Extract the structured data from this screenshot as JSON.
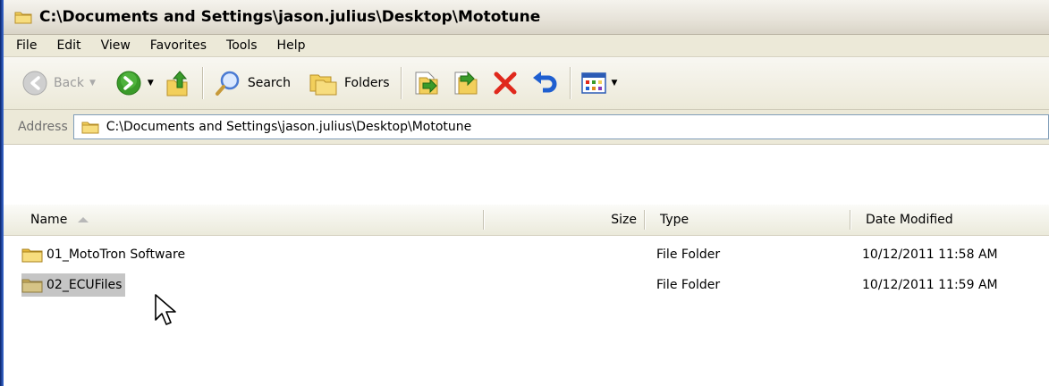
{
  "window": {
    "title": "C:\\Documents and Settings\\jason.julius\\Desktop\\Mototune"
  },
  "menubar": {
    "items": [
      "File",
      "Edit",
      "View",
      "Favorites",
      "Tools",
      "Help"
    ]
  },
  "toolbar": {
    "back_label": "Back",
    "search_label": "Search",
    "folders_label": "Folders"
  },
  "address": {
    "label": "Address",
    "value": "C:\\Documents and Settings\\jason.julius\\Desktop\\Mototune"
  },
  "columns": {
    "name": "Name",
    "size": "Size",
    "type": "Type",
    "date": "Date Modified"
  },
  "files": [
    {
      "name": "01_MotoTron Software",
      "size": "",
      "type": "File Folder",
      "date": "10/12/2011 11:58 AM",
      "selected": false
    },
    {
      "name": "02_ECUFiles",
      "size": "",
      "type": "File Folder",
      "date": "10/12/2011 11:59 AM",
      "selected": true
    }
  ],
  "icons": {
    "title": "folder-icon",
    "back": "back-arrow-icon",
    "forward": "forward-arrow-icon",
    "up": "folder-up-icon",
    "search": "magnifier-icon",
    "folders": "folders-icon",
    "move_to": "move-to-icon",
    "copy_to": "copy-to-icon",
    "delete": "delete-x-icon",
    "undo": "undo-icon",
    "views": "views-icon"
  },
  "colors": {
    "delete_red": "#e0281c",
    "undo_blue": "#1f5fd0",
    "forward_green": "#3a9b2a",
    "folder_yellow": "#f2cf5b",
    "selection_gray": "#c5c5c5"
  }
}
